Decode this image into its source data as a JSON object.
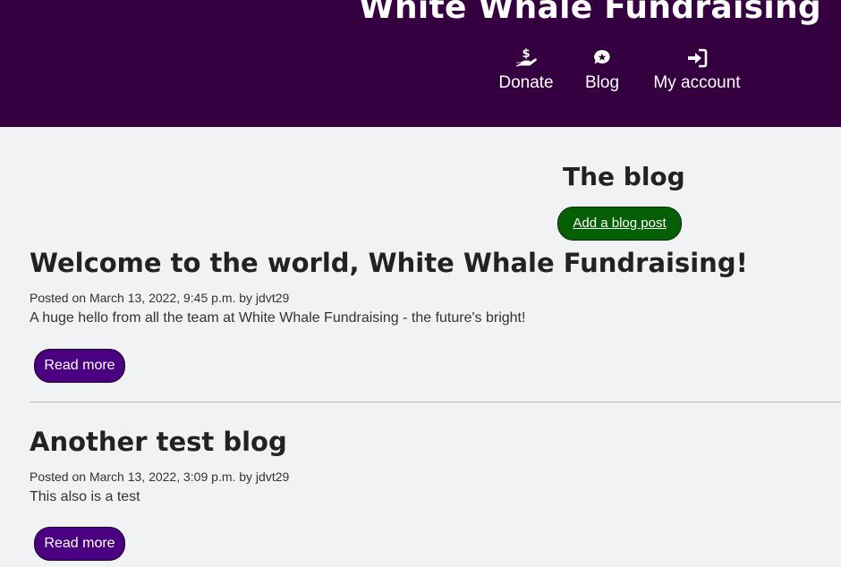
{
  "header": {
    "site_title": "White Whale Fundraising",
    "nav": [
      {
        "label": "Donate",
        "icon": "hand-holding-dollar-icon"
      },
      {
        "label": "Blog",
        "icon": "comment-star-icon"
      },
      {
        "label": "My account",
        "icon": "sign-in-icon"
      }
    ],
    "background_color": "#34003f"
  },
  "main": {
    "heading": "The blog",
    "add_post_label": "Add a blog post",
    "posts": [
      {
        "title": "Welcome to the world, White Whale Fundraising!",
        "meta": "Posted on March 13, 2022, 9:45 p.m. by jdvt29",
        "body": "A huge hello from all the team at White Whale Fundraising - the future's bright!",
        "read_more_label": "Read more"
      },
      {
        "title": "Another test blog",
        "meta": "Posted on March 13, 2022, 3:09 p.m. by jdvt29",
        "body": "This also is a test",
        "read_more_label": "Read more"
      }
    ]
  },
  "colors": {
    "page_background": "#f1f2f4",
    "add_post_button": "#056005",
    "read_more_button": "#4b0082"
  }
}
